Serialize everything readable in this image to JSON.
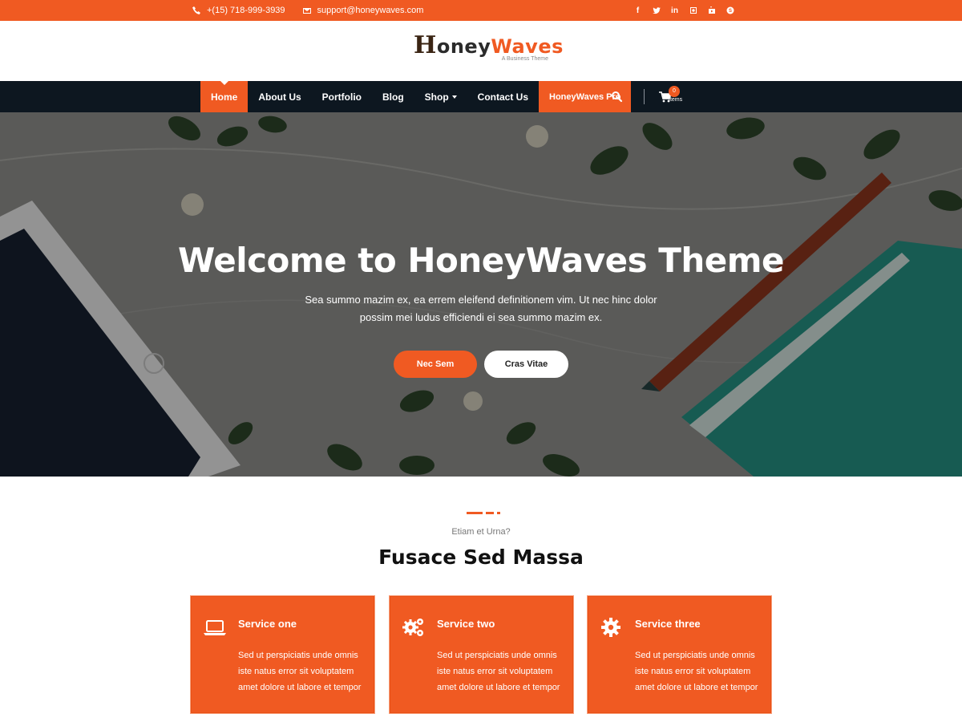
{
  "topbar": {
    "phone": "+(15) 718-999-3939",
    "email": "support@honeywaves.com",
    "social_icons": [
      "facebook-icon",
      "twitter-icon",
      "linkedin-icon",
      "instagram-icon",
      "youtube-icon",
      "skype-icon"
    ]
  },
  "logo": {
    "part1": "H",
    "part2": "oney",
    "part3": "Waves",
    "tagline": "A Business Theme"
  },
  "nav": {
    "items": [
      {
        "label": "Home",
        "active": true
      },
      {
        "label": "About Us"
      },
      {
        "label": "Portfolio"
      },
      {
        "label": "Blog"
      },
      {
        "label": "Shop",
        "dropdown": true
      },
      {
        "label": "Contact Us"
      },
      {
        "label": "HoneyWaves Pro",
        "highlight": true
      }
    ],
    "cart_count": "0",
    "cart_label": "Items"
  },
  "hero": {
    "title": "Welcome to HoneyWaves Theme",
    "text": "Sea summo mazim ex, ea errem eleifend definitionem vim. Ut nec hinc dolor possim mei ludus efficiendi ei sea summo mazim ex.",
    "button_primary": "Nec Sem",
    "button_secondary": "Cras Vitae"
  },
  "services": {
    "kicker": "Etiam et Urna?",
    "heading": "Fusace Sed Massa",
    "cards": [
      {
        "icon": "laptop-icon",
        "title": "Service one",
        "text": "Sed ut perspiciatis unde omnis iste natus error sit voluptatem amet dolore ut labore et tempor"
      },
      {
        "icon": "cogs-icon",
        "title": "Service two",
        "text": "Sed ut perspiciatis unde omnis iste natus error sit voluptatem amet dolore ut labore et tempor"
      },
      {
        "icon": "gear-icon",
        "title": "Service three",
        "text": "Sed ut perspiciatis unde omnis iste natus error sit voluptatem amet dolore ut labore et tempor"
      }
    ]
  },
  "colors": {
    "accent": "#f05a22",
    "nav_bg": "#0d1720"
  }
}
